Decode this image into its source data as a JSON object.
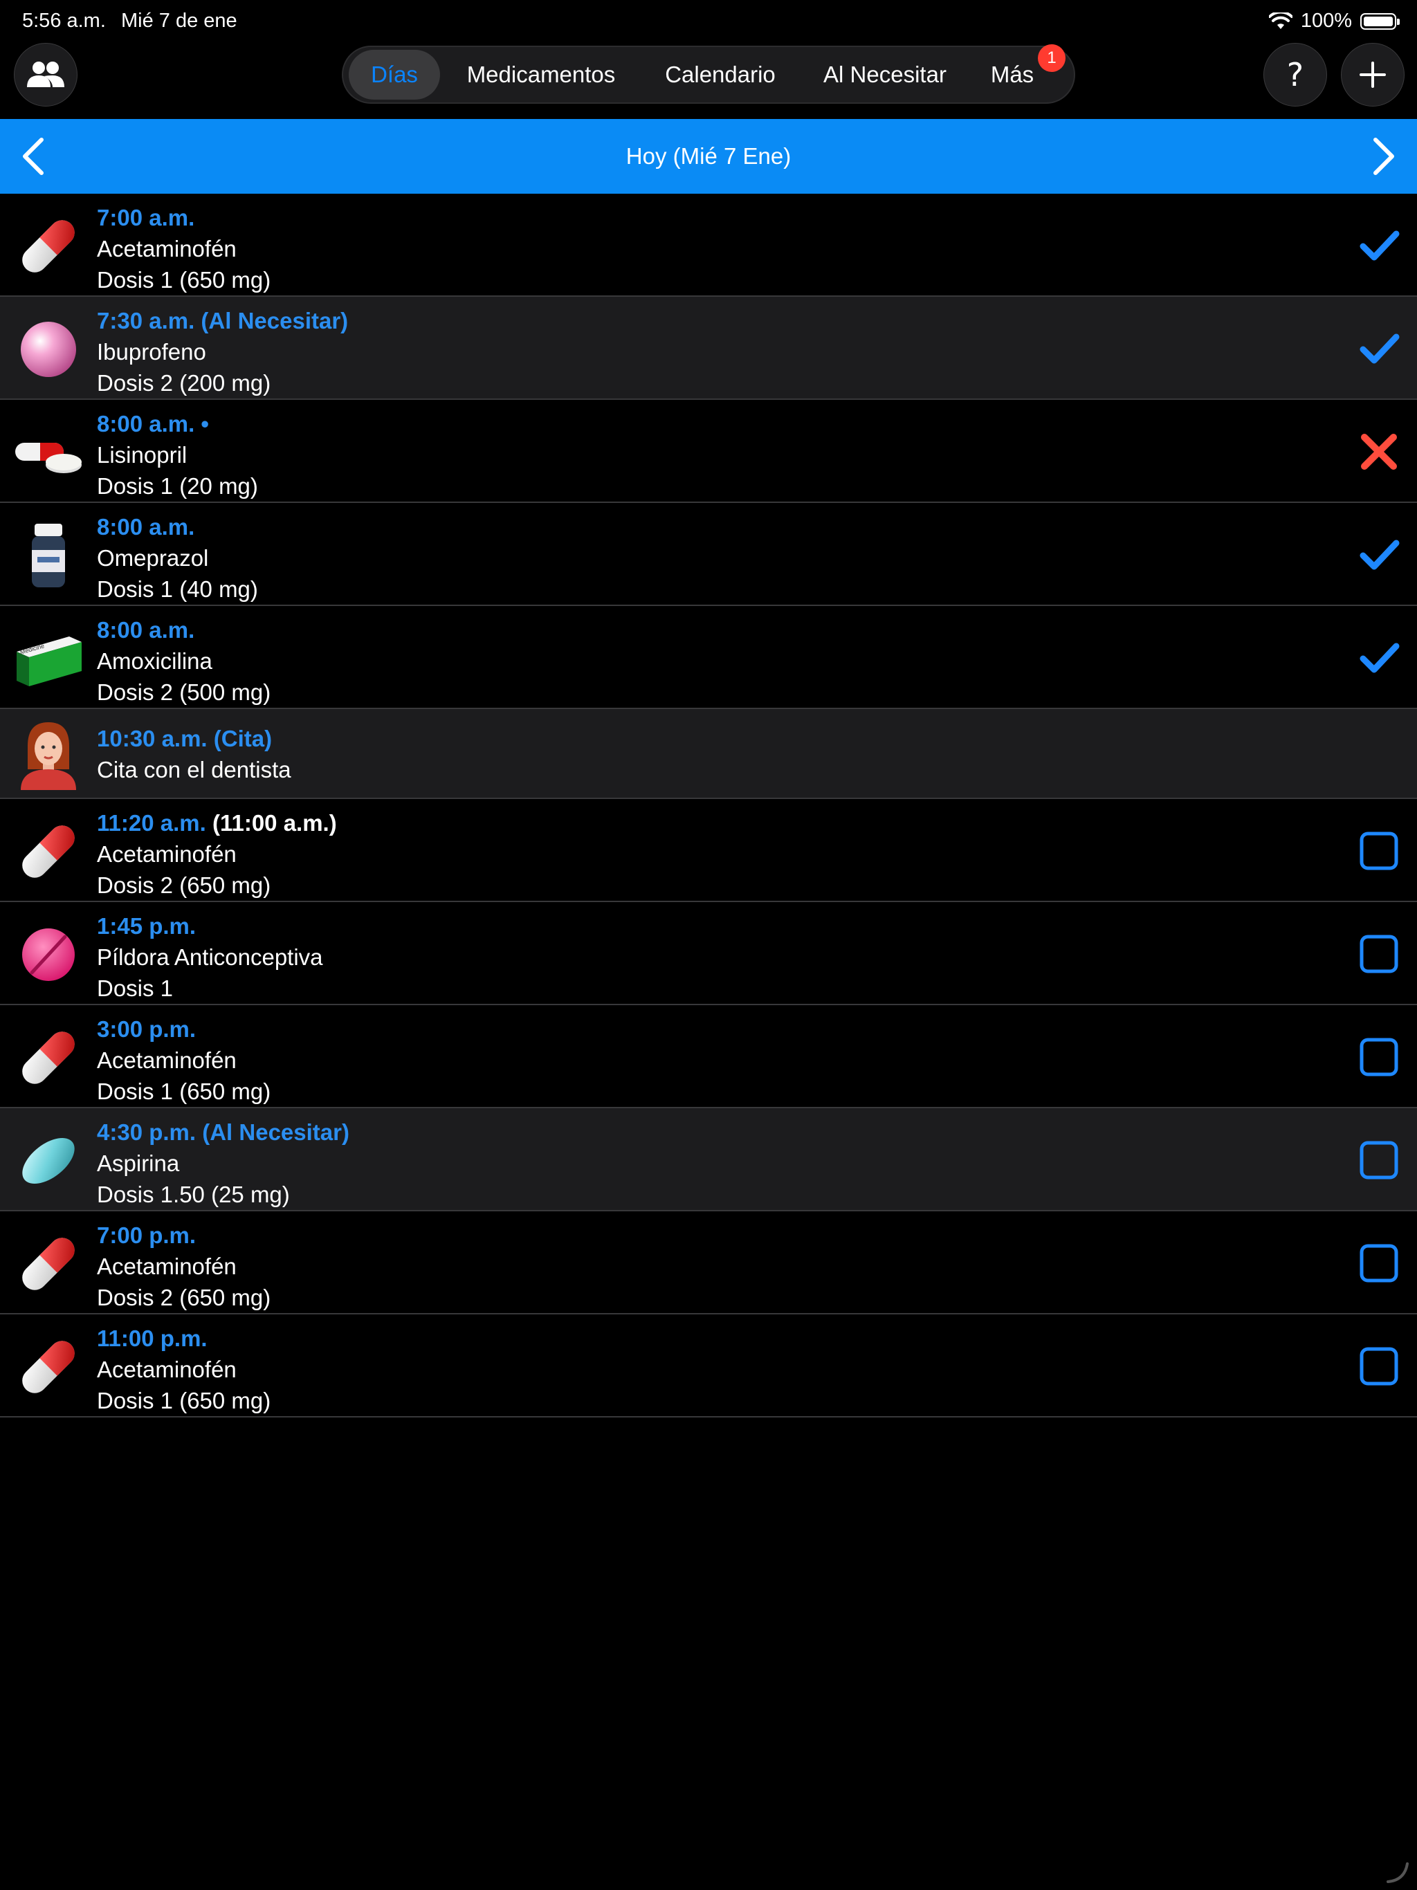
{
  "status_bar": {
    "time": "5:56 a.m.",
    "date": "Mié 7 de ene",
    "battery": "100%",
    "battery_level": 1.0
  },
  "toolbar": {
    "people_icon": "people-icon",
    "help_label": "?",
    "add_icon": "plus-icon",
    "tabs": [
      {
        "label": "Días",
        "active": true
      },
      {
        "label": "Medicamentos",
        "active": false
      },
      {
        "label": "Calendario",
        "active": false
      },
      {
        "label": "Al Necesitar",
        "active": false
      },
      {
        "label": "Más",
        "active": false,
        "badge": "1"
      }
    ]
  },
  "day_header": {
    "title": "Hoy (Mié 7 Ene)",
    "prev_icon": "chevron-left-icon",
    "next_icon": "chevron-right-icon"
  },
  "accent_color": "#0a84ff",
  "header_color": "#0a8bf5",
  "schedule": [
    {
      "time": "7:00 a.m.",
      "name": "Acetaminofén",
      "dose": "Dosis 1 (650 mg)",
      "icon": "red-capsule-icon",
      "status": "taken"
    },
    {
      "time": "7:30 a.m. (Al Necesitar)",
      "name": "Ibuprofeno",
      "dose": "Dosis 2 (200 mg)",
      "icon": "pink-ball-pill-icon",
      "status": "taken",
      "alt": true
    },
    {
      "time": "8:00 a.m. •",
      "name": "Lisinopril",
      "dose": "Dosis 1 (20 mg)",
      "icon": "capsule-and-tablet-icon",
      "status": "skipped"
    },
    {
      "time": "8:00 a.m.",
      "name": "Omeprazol",
      "dose": "Dosis 1 (40 mg)",
      "icon": "pill-bottle-icon",
      "status": "taken"
    },
    {
      "time": "8:00 a.m.",
      "name": "Amoxicilina",
      "dose": "Dosis 2 (500 mg)",
      "icon": "medicine-box-icon",
      "status": "taken"
    },
    {
      "time": "10:30 a.m. (Cita)",
      "name": "Cita con el dentista",
      "icon": "woman-avatar-icon",
      "status": "appointment",
      "alt": true
    },
    {
      "time": "11:20 a.m.",
      "original_time": "(11:00 a.m.)",
      "name": "Acetaminofén",
      "dose": "Dosis 2 (650 mg)",
      "icon": "red-capsule-icon",
      "status": "pending"
    },
    {
      "time": "1:45 p.m.",
      "name": "Píldora Anticonceptiva",
      "dose": "Dosis 1",
      "icon": "pink-tablet-icon",
      "status": "pending"
    },
    {
      "time": "3:00 p.m.",
      "name": "Acetaminofén",
      "dose": "Dosis 1 (650 mg)",
      "icon": "red-capsule-icon",
      "status": "pending"
    },
    {
      "time": "4:30 p.m. (Al Necesitar)",
      "name": "Aspirina",
      "dose": "Dosis 1.50 (25 mg)",
      "icon": "teal-oval-tablet-icon",
      "status": "pending",
      "alt": true
    },
    {
      "time": "7:00 p.m.",
      "name": "Acetaminofén",
      "dose": "Dosis 2 (650 mg)",
      "icon": "red-capsule-icon",
      "status": "pending"
    },
    {
      "time": "11:00 p.m.",
      "name": "Acetaminofén",
      "dose": "Dosis 1 (650 mg)",
      "icon": "red-capsule-icon",
      "status": "pending"
    }
  ]
}
